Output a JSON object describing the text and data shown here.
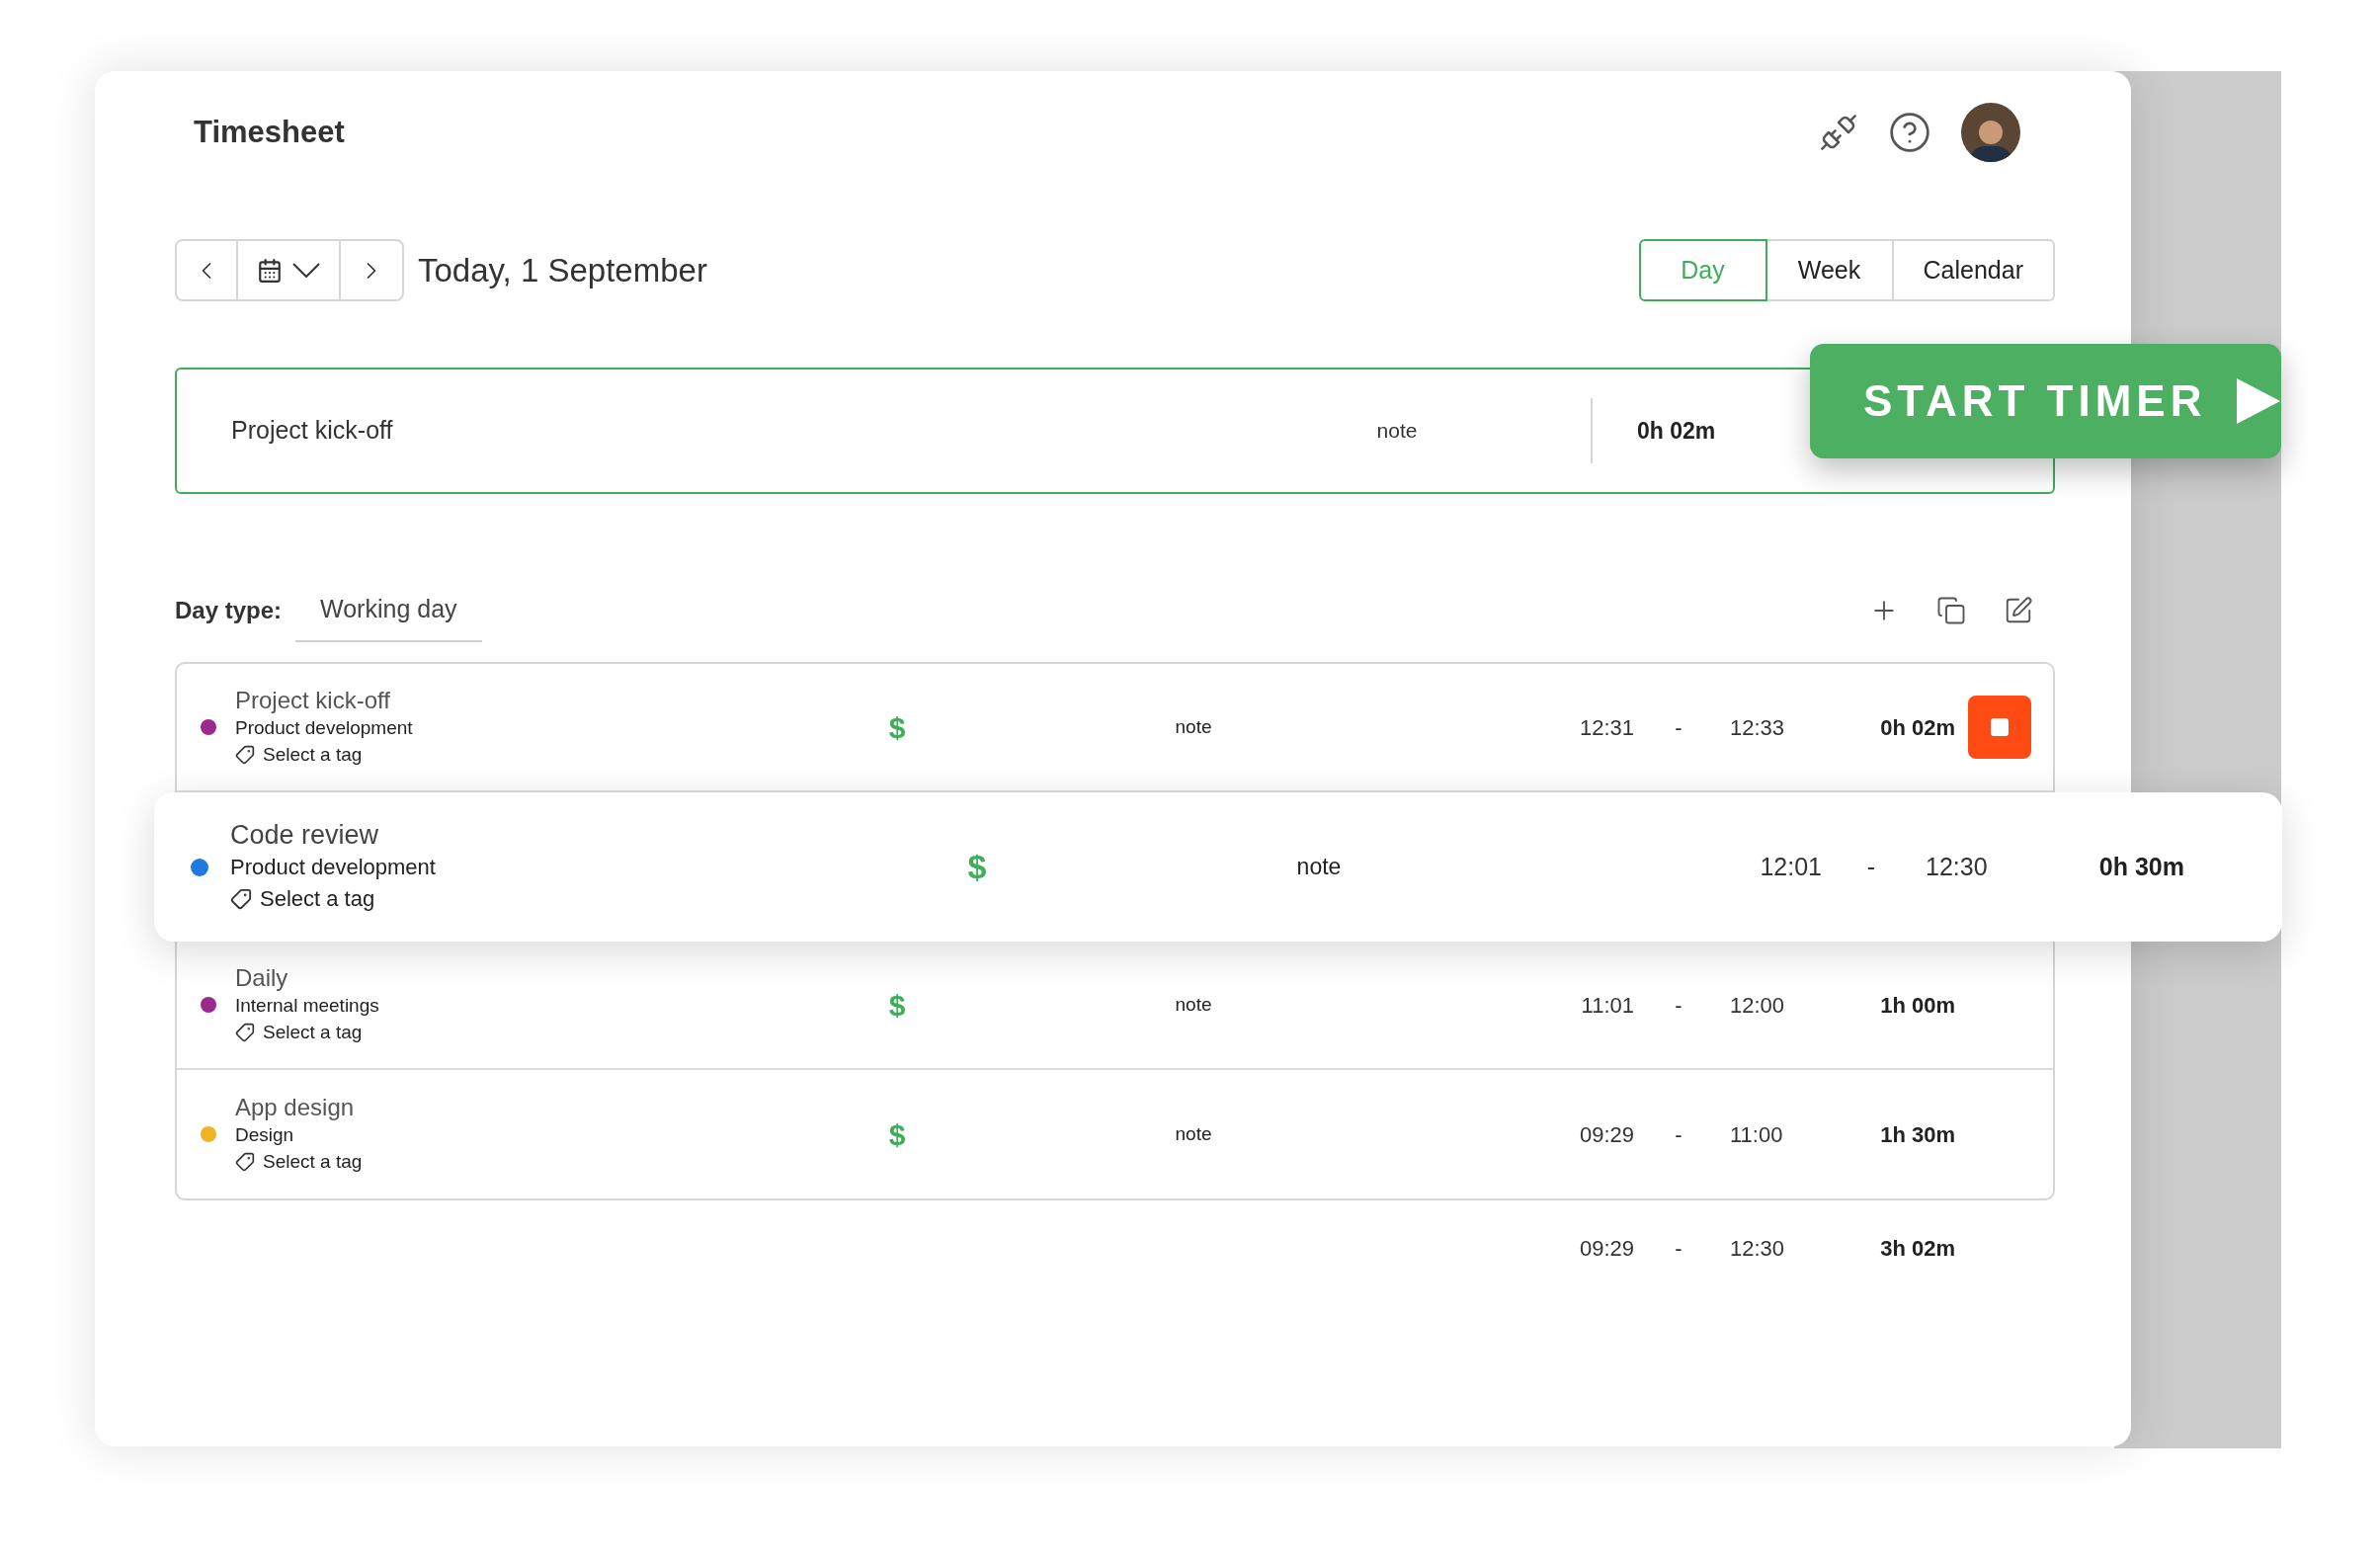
{
  "header": {
    "title": "Timesheet"
  },
  "date_nav": {
    "label": "Today, 1 September"
  },
  "view_tabs": [
    {
      "label": "Day",
      "selected": true
    },
    {
      "label": "Week",
      "selected": false
    },
    {
      "label": "Calendar",
      "selected": false
    }
  ],
  "timer": {
    "task": "Project kick-off",
    "note": "note",
    "duration": "0h 02m",
    "button": "START TIMER"
  },
  "day_type": {
    "label": "Day type:",
    "value": "Working day"
  },
  "entries": [
    {
      "task": "Project kick-off",
      "project": "Product development",
      "tag": "Select a tag",
      "billable": "$",
      "note": "note",
      "start": "12:31",
      "dash": "-",
      "end": "12:33",
      "duration": "0h 02m",
      "color": "#9c2a8c",
      "running": true,
      "highlighted": false
    },
    {
      "task": "Code review",
      "project": "Product development",
      "tag": "Select a tag",
      "billable": "$",
      "note": "note",
      "start": "12:01",
      "dash": "-",
      "end": "12:30",
      "duration": "0h 30m",
      "color": "#1f7ae0",
      "running": false,
      "highlighted": true
    },
    {
      "task": "Daily",
      "project": "Internal meetings",
      "tag": "Select a tag",
      "billable": "$",
      "note": "note",
      "start": "11:01",
      "dash": "-",
      "end": "12:00",
      "duration": "1h 00m",
      "color": "#9c2a8c",
      "running": false,
      "highlighted": false
    },
    {
      "task": "App design",
      "project": "Design",
      "tag": "Select a tag",
      "billable": "$",
      "note": "note",
      "start": "09:29",
      "dash": "-",
      "end": "11:00",
      "duration": "1h 30m",
      "color": "#f0b323",
      "running": false,
      "highlighted": false
    }
  ],
  "total": {
    "start": "09:29",
    "dash": "-",
    "end": "12:30",
    "duration": "3h 02m"
  }
}
